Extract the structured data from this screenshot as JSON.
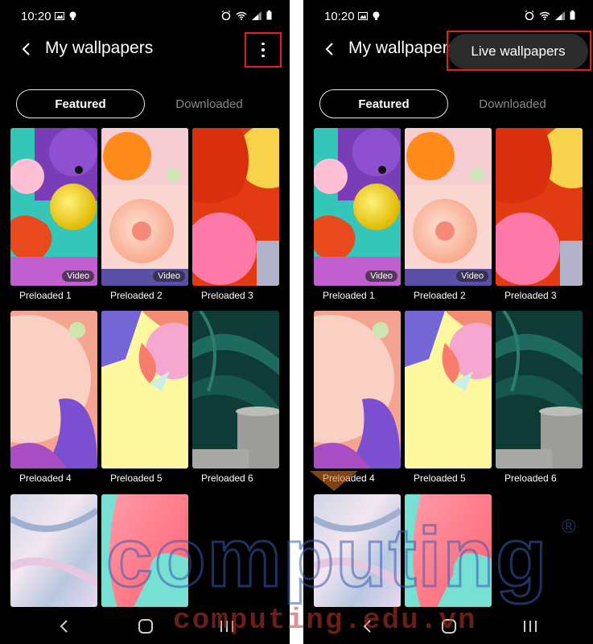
{
  "status_bar": {
    "time": "10:20"
  },
  "app_bar": {
    "title": "My wallpapers"
  },
  "tabs": [
    {
      "label": "Featured",
      "selected": true
    },
    {
      "label": "Downloaded",
      "selected": false
    }
  ],
  "wallpapers": [
    {
      "label": "Preloaded 1",
      "badge": "Video"
    },
    {
      "label": "Preloaded 2",
      "badge": "Video"
    },
    {
      "label": "Preloaded 3",
      "badge": ""
    },
    {
      "label": "Preloaded 4",
      "badge": ""
    },
    {
      "label": "Preloaded 5",
      "badge": ""
    },
    {
      "label": "Preloaded 6",
      "badge": ""
    },
    {
      "label": "",
      "badge": ""
    },
    {
      "label": "",
      "badge": ""
    }
  ],
  "popup_menu": {
    "item": "Live wallpapers"
  },
  "watermark": {
    "logo": "computing",
    "mark": "®",
    "url": "computing.edu.vn"
  },
  "colors": {
    "highlight": "#e02020",
    "background": "#000000",
    "inactive_tab": "#8a8a8a"
  }
}
